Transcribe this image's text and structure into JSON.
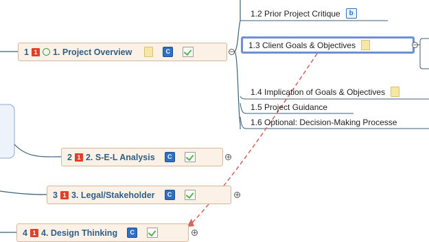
{
  "topics": [
    {
      "num": "1",
      "priority": "1",
      "title": "1. Project Overview",
      "icons": [
        "priority-icon",
        "progress-icon",
        "note-icon",
        "c-icon",
        "task-icon"
      ]
    },
    {
      "num": "2",
      "priority": "1",
      "title": "2. S-E-L Analysis",
      "icons": [
        "priority-icon",
        "c-icon",
        "task-icon"
      ]
    },
    {
      "num": "3",
      "priority": "1",
      "title": "3. Legal/Stakeholder",
      "icons": [
        "priority-icon",
        "c-icon",
        "task-icon"
      ]
    },
    {
      "num": "4",
      "priority": "1",
      "title": "4. Design Thinking",
      "icons": [
        "priority-icon",
        "c-icon",
        "task-icon"
      ]
    }
  ],
  "subtopics": [
    {
      "text": "1.2  Prior Project Critique",
      "icon": "b-icon",
      "badge": "b"
    },
    {
      "text": "1.3  Client Goals & Objectives",
      "icon": "note-icon"
    },
    {
      "text": "1.4  Implication of Goals & Objectives",
      "icon": "note-icon"
    },
    {
      "text": "1.5  Project Guidance"
    },
    {
      "text": "1.6  Optional: Decision-Making Processe"
    }
  ],
  "badge_c": "C",
  "collapse_symbol": "⊖",
  "expand_symbol": "⊕",
  "colors": {
    "topic_fill": "#fbf1e6",
    "topic_border": "#d7b79b",
    "topic_text": "#2f5f86",
    "priority": "#e0402b",
    "selection": "#6c8ed2",
    "relationship_arrow": "#d46a5e",
    "connector": "#3b5f7a"
  }
}
